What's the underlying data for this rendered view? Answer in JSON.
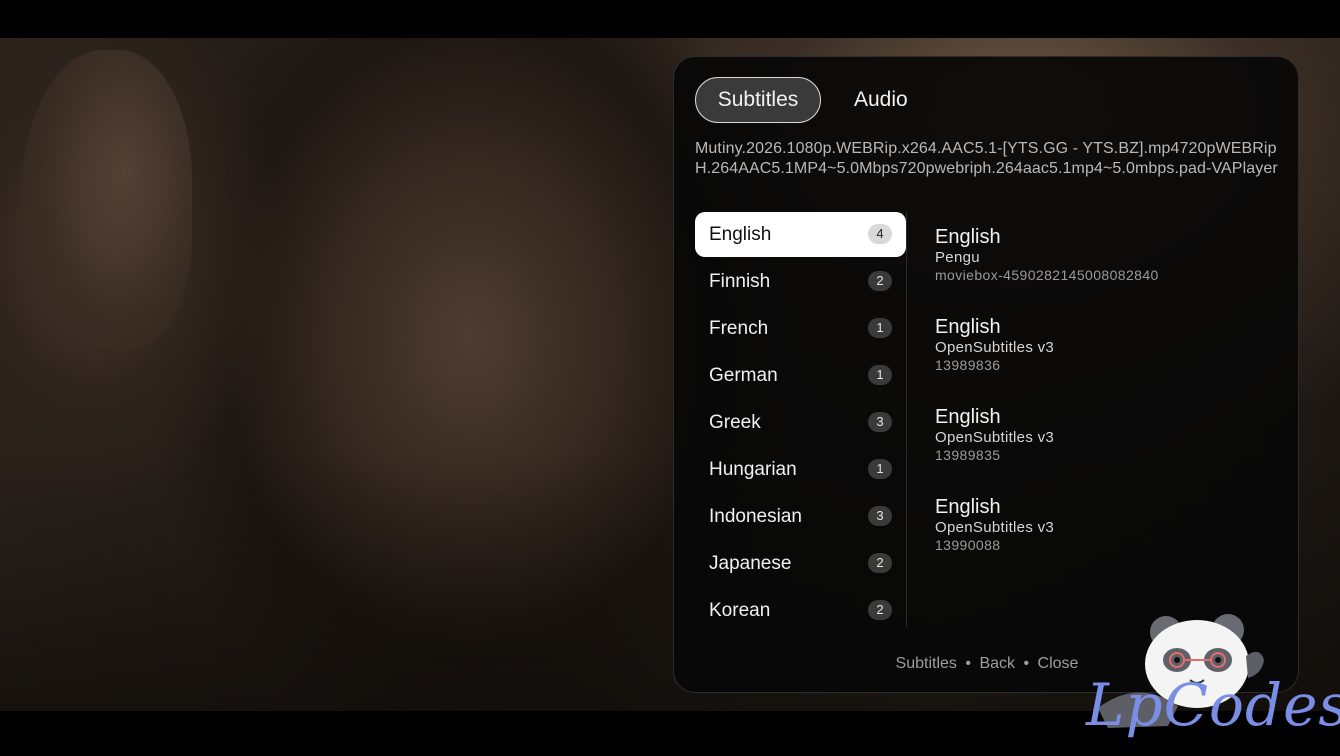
{
  "tabs": [
    {
      "label": "Subtitles",
      "active": true
    },
    {
      "label": "Audio",
      "active": false
    }
  ],
  "filename": "Mutiny.2026.1080p.WEBRip.x264.AAC5.1-[YTS.GG - YTS.BZ].mp4720pWEBRipH.264AAC5.1MP4~5.0Mbps720pwebriph.264aac5.1mp4~5.0mbps.pad-VAPlayer",
  "languages": [
    {
      "name": "English",
      "count": "4"
    },
    {
      "name": "Finnish",
      "count": "2"
    },
    {
      "name": "French",
      "count": "1"
    },
    {
      "name": "German",
      "count": "1"
    },
    {
      "name": "Greek",
      "count": "3"
    },
    {
      "name": "Hungarian",
      "count": "1"
    },
    {
      "name": "Indonesian",
      "count": "3"
    },
    {
      "name": "Japanese",
      "count": "2"
    },
    {
      "name": "Korean",
      "count": "2"
    }
  ],
  "selected_language_index": 0,
  "subtitle_tracks": [
    {
      "language": "English",
      "provider": "Pengu",
      "id": "moviebox-4590282145008082840"
    },
    {
      "language": "English",
      "provider": "OpenSubtitles v3",
      "id": "13989836"
    },
    {
      "language": "English",
      "provider": "OpenSubtitles v3",
      "id": "13989835"
    },
    {
      "language": "English",
      "provider": "OpenSubtitles v3",
      "id": "13990088"
    }
  ],
  "footer": {
    "subtitles": "Subtitles",
    "sep": "•",
    "back": "Back",
    "close": "Close"
  },
  "logo": {
    "text": "LpCodes",
    "icon": "panda-mascot-icon"
  },
  "colors": {
    "accent_logo": "#7b8ee6",
    "panel_bg": "#080808",
    "active_item": "#ffffff"
  }
}
